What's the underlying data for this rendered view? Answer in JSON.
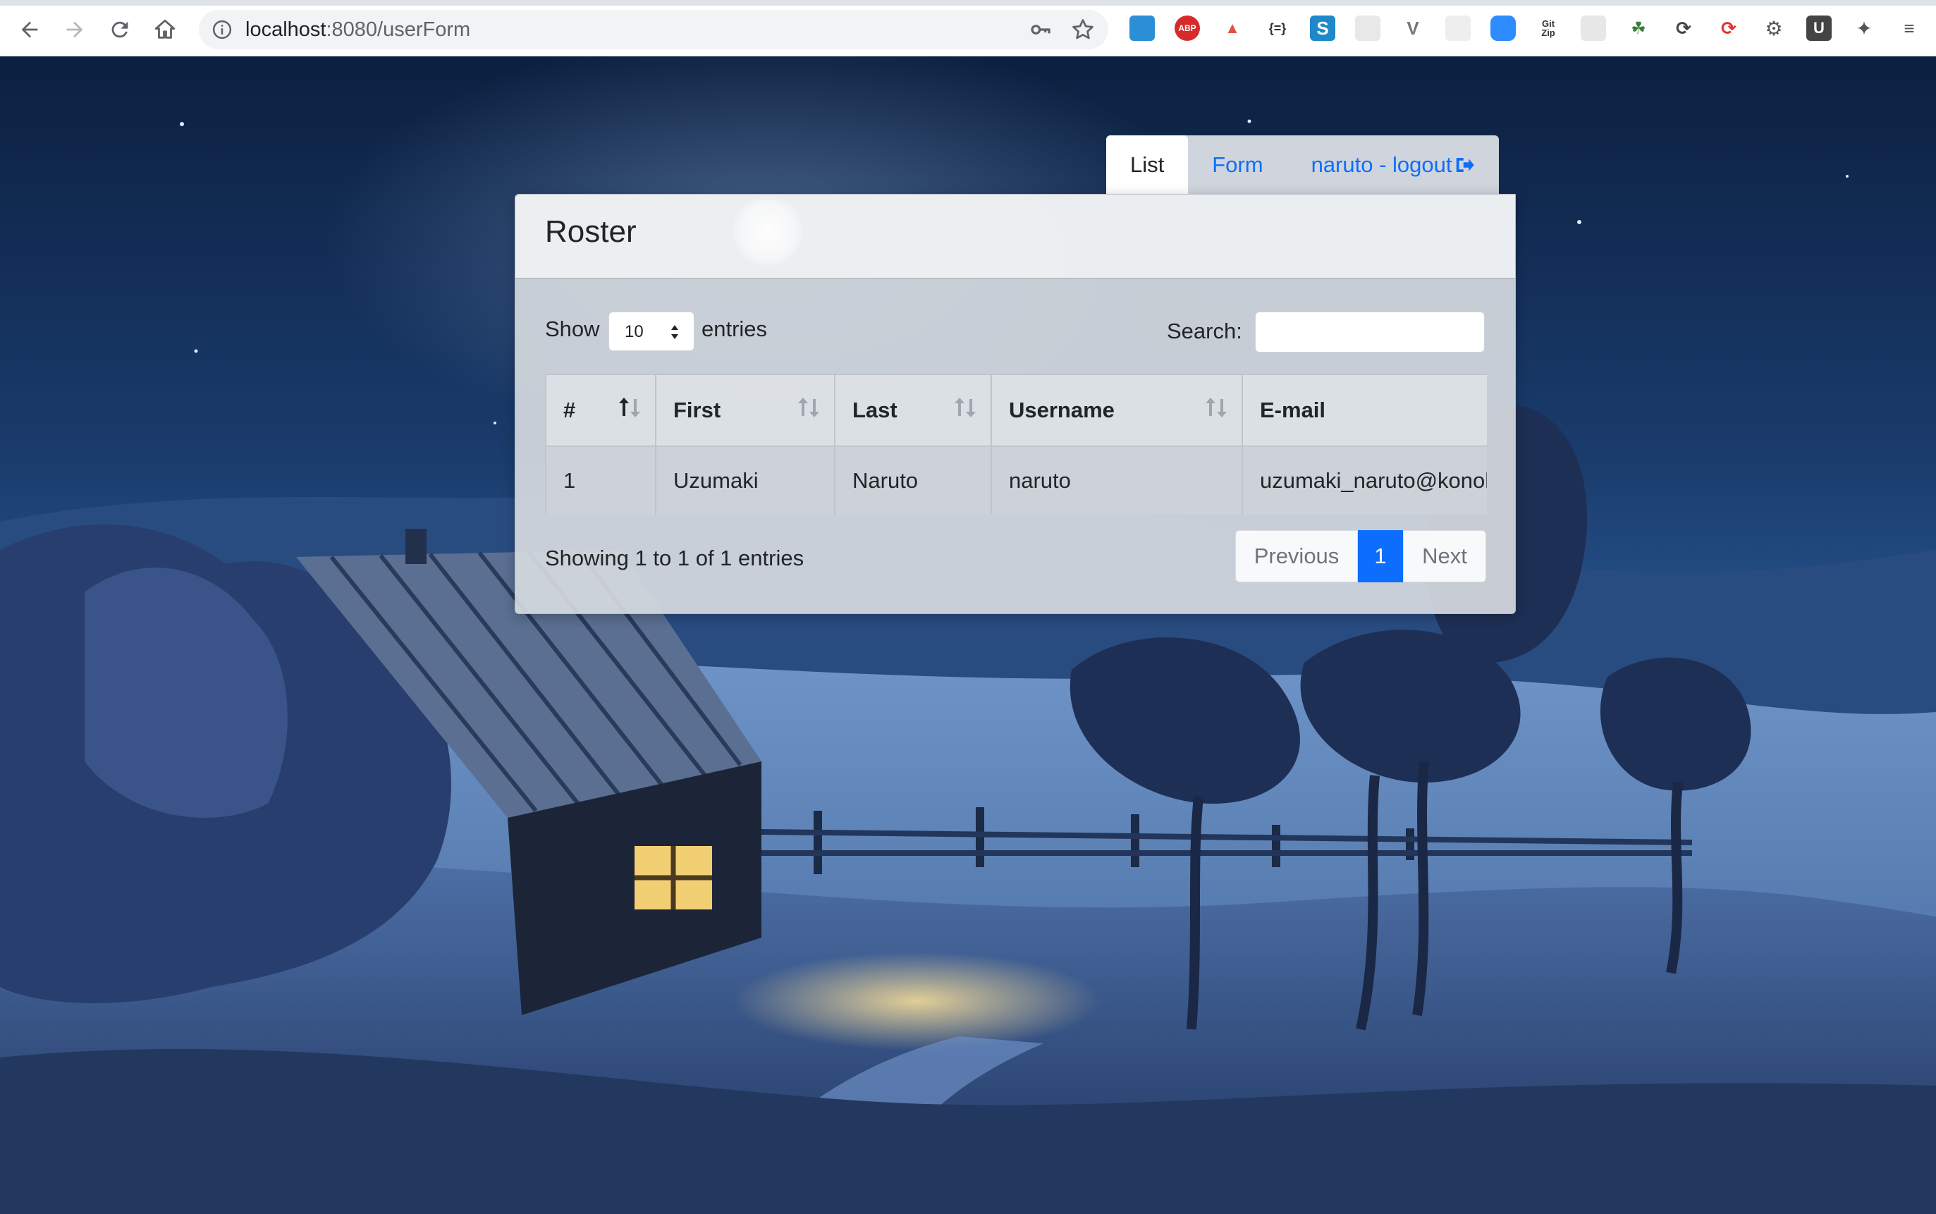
{
  "browser": {
    "url_host": "localhost",
    "url_path": ":8080/userForm"
  },
  "nav_tabs": [
    {
      "label": "List",
      "active": true
    },
    {
      "label": "Form",
      "active": false
    },
    {
      "label": "naruto - logout",
      "active": false
    }
  ],
  "card": {
    "title": "Roster",
    "show_label": "Show",
    "page_length": "10",
    "entries_label": "entries",
    "search_label": "Search:",
    "search_value": ""
  },
  "table": {
    "columns": [
      "#",
      "First",
      "Last",
      "Username",
      "E-mail"
    ],
    "rows": [
      [
        "1",
        "Uzumaki",
        "Naruto",
        "naruto",
        "uzumaki_naruto@konoha.com"
      ]
    ]
  },
  "footer": {
    "info": "Showing 1 to 1 of 1 entries",
    "previous": "Previous",
    "current_page": "1",
    "next": "Next"
  },
  "colors": {
    "link": "#0d6efd",
    "active_page": "#0d6efd"
  }
}
